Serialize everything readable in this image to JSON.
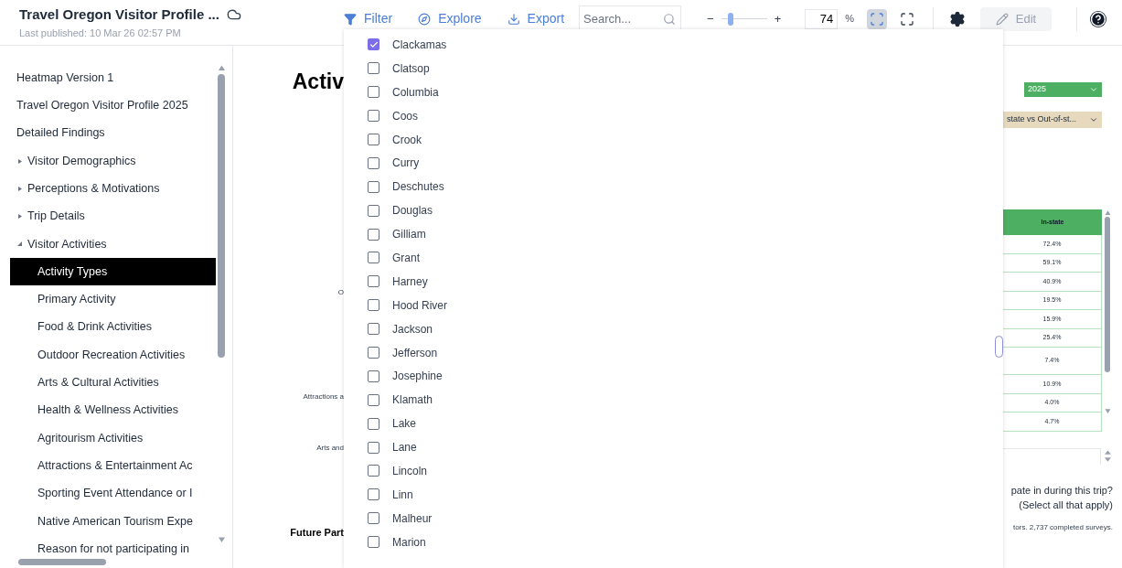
{
  "header": {
    "title": "Travel Oregon Visitor Profile ...",
    "published": "Last published: 10 Mar 26 02:57 PM",
    "actions": [
      {
        "label": "Filter",
        "kind": "filter"
      },
      {
        "label": "Explore",
        "kind": "explore"
      },
      {
        "label": "Export",
        "kind": "export"
      }
    ],
    "search": {
      "placeholder": "Search..."
    },
    "zoom": {
      "minus": "−",
      "plus": "+",
      "level": 0.2,
      "value": "74",
      "unit": "%"
    },
    "fit": {
      "selected": true
    },
    "edit": {
      "label": "Edit",
      "disabled": true
    }
  },
  "sidebar": {
    "items": [
      {
        "label": "Heatmap Version 1"
      },
      {
        "label": "Travel Oregon Visitor Profile 2025"
      },
      {
        "label": "Detailed Findings",
        "children": [
          {
            "label": "Visitor Demographics",
            "expanded": false
          },
          {
            "label": "Perceptions & Motivations",
            "expanded": false
          },
          {
            "label": "Trip Details",
            "expanded": false
          },
          {
            "label": "Visitor Activities",
            "expanded": true,
            "children": [
              {
                "label": "Activity Types",
                "selected": true
              },
              {
                "label": "Primary Activity",
                "selected": false
              },
              {
                "label": "Food & Drink Activities",
                "selected": false
              },
              {
                "label": "Outdoor Recreation Activities",
                "selected": false
              },
              {
                "label": "Arts & Cultural Activities",
                "selected": false
              },
              {
                "label": "Health & Wellness Activities",
                "selected": false
              },
              {
                "label": "Agritourism Activities",
                "selected": false
              },
              {
                "label": "Attractions & Entertainment Ac",
                "selected": false
              },
              {
                "label": "Sporting Event Attendance or I",
                "selected": false
              },
              {
                "label": "Native American Tourism Expe",
                "selected": false
              },
              {
                "label": "Reason for not participating in",
                "selected": false
              }
            ]
          }
        ]
      }
    ]
  },
  "report": {
    "title": "Activ",
    "labels": [
      "O",
      "Attractions a",
      "Arts and"
    ],
    "section": "Future Part",
    "year_select": "2025",
    "compare_select": "state vs Out-of-st...",
    "table": {
      "columns": [
        "In-state"
      ],
      "rows": [
        "72.4%",
        "59.1%",
        "40.9%",
        "19.5%",
        "15.9%",
        "25.4%",
        "7.4%",
        "10.9%",
        "4.0%",
        "4.7%"
      ]
    },
    "question": [
      "pate in during this trip?",
      "(Select all that apply)"
    ],
    "note": "tors. 2,737 completed surveys."
  },
  "filter_menu": {
    "options": [
      {
        "label": "Clackamas",
        "checked": true
      },
      {
        "label": "Clatsop",
        "checked": false
      },
      {
        "label": "Columbia",
        "checked": false
      },
      {
        "label": "Coos",
        "checked": false
      },
      {
        "label": "Crook",
        "checked": false
      },
      {
        "label": "Curry",
        "checked": false
      },
      {
        "label": "Deschutes",
        "checked": false
      },
      {
        "label": "Douglas",
        "checked": false
      },
      {
        "label": "Gilliam",
        "checked": false
      },
      {
        "label": "Grant",
        "checked": false
      },
      {
        "label": "Harney",
        "checked": false
      },
      {
        "label": "Hood River",
        "checked": false
      },
      {
        "label": "Jackson",
        "checked": false
      },
      {
        "label": "Jefferson",
        "checked": false
      },
      {
        "label": "Josephine",
        "checked": false
      },
      {
        "label": "Klamath",
        "checked": false
      },
      {
        "label": "Lake",
        "checked": false
      },
      {
        "label": "Lane",
        "checked": false
      },
      {
        "label": "Lincoln",
        "checked": false
      },
      {
        "label": "Linn",
        "checked": false
      },
      {
        "label": "Malheur",
        "checked": false
      },
      {
        "label": "Marion",
        "checked": false
      }
    ]
  }
}
